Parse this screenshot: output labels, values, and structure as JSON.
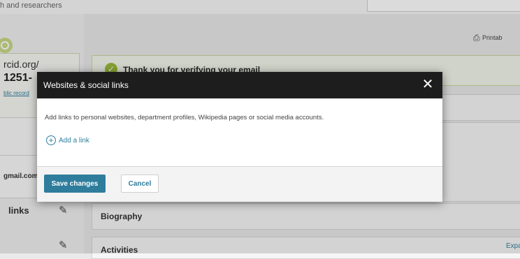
{
  "background": {
    "tagline": "h and researchers",
    "orcid_url": "rcid.org/",
    "orcid_number": "1251-",
    "public_record_link": "blic record",
    "email": "gmail.com",
    "links_label": "links",
    "printable_label": "Printab",
    "verify_message": "Thank you for verifying your email",
    "biography_title": "Biography",
    "activities_title": "Activities",
    "expand_label": "Expa"
  },
  "modal": {
    "title": "Websites & social links",
    "close_symbol": "✕",
    "description": "Add links to personal websites, department profiles, Wikipedia pages or social media accounts.",
    "add_link_label": "Add a link",
    "save_label": "Save changes",
    "cancel_label": "Cancel"
  },
  "icons": {
    "printer": "printer-icon",
    "pencil": "pencil-icon",
    "plus": "plus-circle-icon",
    "check": "check-circle-icon",
    "close": "close-icon"
  },
  "colors": {
    "accent": "#2f7d9c",
    "header": "#1d1d1d",
    "success": "#9bbb3a"
  }
}
